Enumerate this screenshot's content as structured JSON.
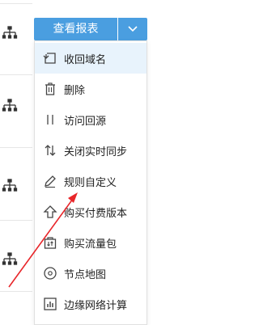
{
  "toolbar": {
    "report_button_label": "查看报表",
    "dropdown_icon": "chevron-down-icon"
  },
  "menu": {
    "items": [
      {
        "label": "收回域名",
        "icon": "reclaim-domain-icon",
        "active": true
      },
      {
        "label": "删除",
        "icon": "trash-icon"
      },
      {
        "label": "访问回源",
        "icon": "origin-pull-icon"
      },
      {
        "label": "关闭实时同步",
        "icon": "sync-arrows-icon"
      },
      {
        "label": "规则自定义",
        "icon": "pencil-icon"
      },
      {
        "label": "购买付费版本",
        "icon": "upgrade-arrow-icon"
      },
      {
        "label": "购买流量包",
        "icon": "traffic-package-icon"
      },
      {
        "label": "节点地图",
        "icon": "map-pin-icon"
      },
      {
        "label": "边缘网络计算",
        "icon": "bar-chart-icon"
      }
    ]
  },
  "colors": {
    "button": "#4a9ee0",
    "active_item_bg": "#e8f3fc",
    "annotation_arrow": "#e8262a"
  }
}
